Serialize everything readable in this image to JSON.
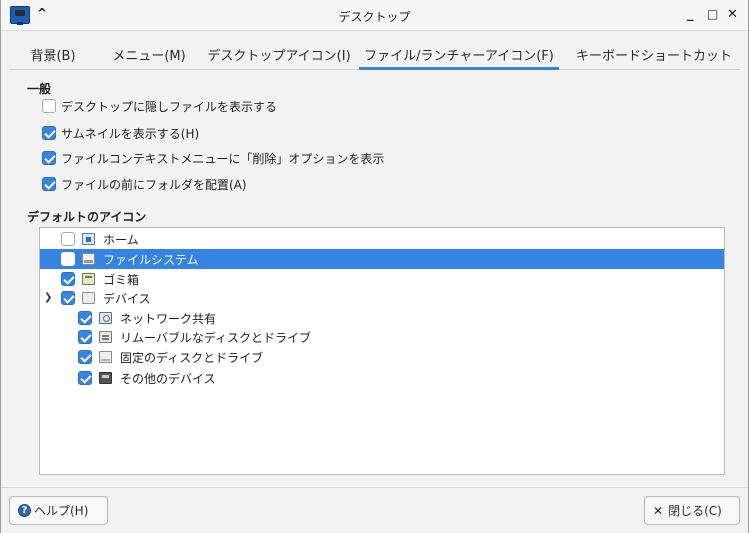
{
  "window": {
    "title": "デスクトップ",
    "collapse_glyph": "^",
    "minimize_glyph": "_",
    "maximize_glyph": "□",
    "close_glyph": "✕"
  },
  "tabs": [
    {
      "label": "背景(B)",
      "active": false
    },
    {
      "label": "メニュー(M)",
      "active": false
    },
    {
      "label": "デスクトップアイコン(I)",
      "active": false
    },
    {
      "label": "ファイル/ランチャーアイコン(F)",
      "active": true
    },
    {
      "label": "キーボードショートカット",
      "active": false
    }
  ],
  "general": {
    "title": "一般",
    "options": [
      {
        "label": "デスクトップに隠しファイルを表示する",
        "checked": false
      },
      {
        "label": "サムネイルを表示する(H)",
        "checked": true
      },
      {
        "label": "ファイルコンテキストメニューに「削除」オプションを表示",
        "checked": true
      },
      {
        "label": "ファイルの前にフォルダを配置(A)",
        "checked": true
      }
    ]
  },
  "default_icons": {
    "title": "デフォルトのアイコン",
    "items": [
      {
        "label": "ホーム",
        "checked": false,
        "icon": "home-folder-icon",
        "selected": false
      },
      {
        "label": "ファイルシステム",
        "checked": false,
        "icon": "filesystem-drive-icon",
        "selected": true
      },
      {
        "label": "ゴミ箱",
        "checked": true,
        "icon": "trash-icon",
        "selected": false
      },
      {
        "label": "デバイス",
        "checked": true,
        "icon": "devices-icon",
        "selected": false,
        "expanded": true
      },
      {
        "label": "ネットワーク共有",
        "checked": true,
        "icon": "network-share-icon",
        "selected": false
      },
      {
        "label": "リムーバブルなディスクとドライブ",
        "checked": true,
        "icon": "removable-drive-icon",
        "selected": false
      },
      {
        "label": "固定のディスクとドライブ",
        "checked": true,
        "icon": "fixed-drive-icon",
        "selected": false
      },
      {
        "label": "その他のデバイス",
        "checked": true,
        "icon": "other-device-icon",
        "selected": false
      }
    ]
  },
  "buttons": {
    "help_label": "ヘルプ(H)",
    "close_label": "閉じる(C)"
  },
  "colors": {
    "accent": "#3584e4"
  }
}
